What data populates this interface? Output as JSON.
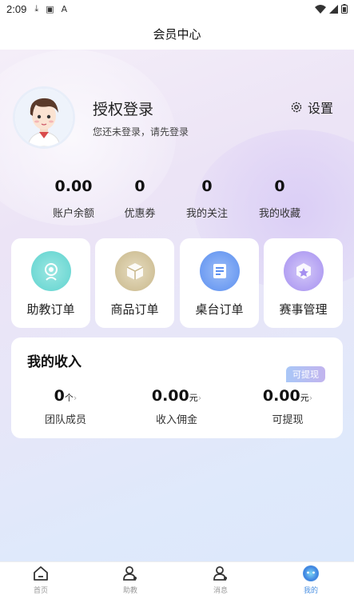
{
  "status_bar": {
    "time": "2:09"
  },
  "header": {
    "title": "会员中心"
  },
  "profile": {
    "name": "授权登录",
    "subtitle": "您还未登录，请先登录",
    "settings_label": "设置"
  },
  "stats": [
    {
      "value": "0.00",
      "label": "账户余额"
    },
    {
      "value": "0",
      "label": "优惠券"
    },
    {
      "value": "0",
      "label": "我的关注"
    },
    {
      "value": "0",
      "label": "我的收藏"
    }
  ],
  "tiles": [
    {
      "label": "助教订单",
      "icon": "coach-icon",
      "color": "#5fd3cf"
    },
    {
      "label": "商品订单",
      "icon": "box-icon",
      "color": "#c8b78a"
    },
    {
      "label": "桌台订单",
      "icon": "receipt-icon",
      "color": "#5b8ff0"
    },
    {
      "label": "赛事管理",
      "icon": "trophy-icon",
      "color": "#a58ff0"
    }
  ],
  "income": {
    "title": "我的收入",
    "badge": "可提现",
    "items": [
      {
        "value": "0",
        "unit": "个",
        "label": "团队成员"
      },
      {
        "value": "0.00",
        "unit": "元",
        "label": "收入佣金"
      },
      {
        "value": "0.00",
        "unit": "元",
        "label": "可提现"
      }
    ]
  },
  "tabbar": [
    {
      "label": "首页",
      "icon": "home-icon"
    },
    {
      "label": "助教",
      "icon": "coach-tab-icon"
    },
    {
      "label": "消息",
      "icon": "message-icon"
    },
    {
      "label": "我的",
      "icon": "profile-icon",
      "active": true
    }
  ]
}
